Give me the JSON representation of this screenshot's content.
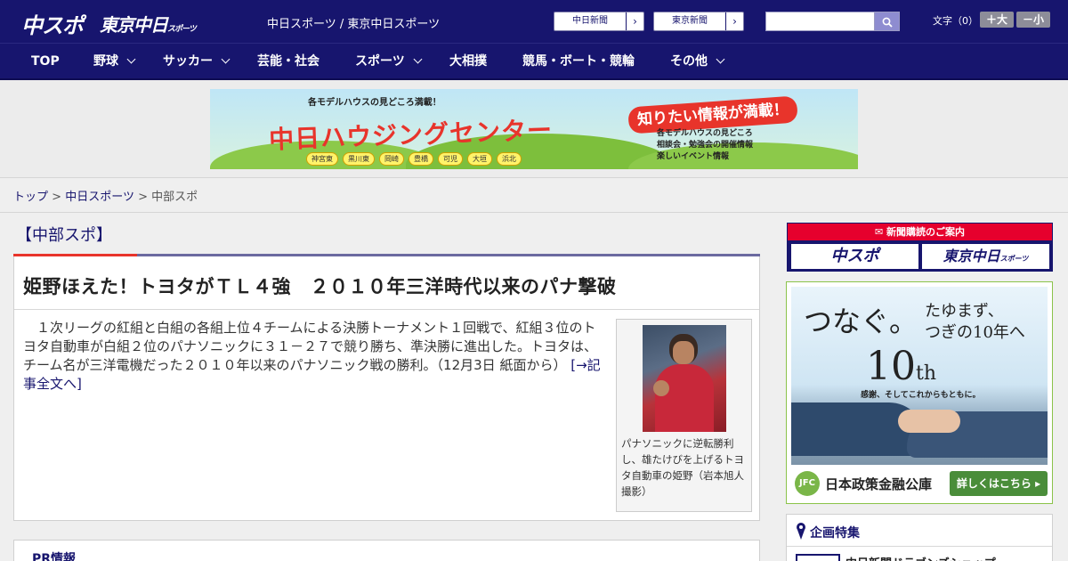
{
  "header": {
    "logo_primary": "中スポ",
    "logo_secondary": "東京中日",
    "logo_secondary_small": "スポーツ",
    "site_names": "中日スポーツ / 東京中日スポーツ",
    "link_chunichi": "中日新聞",
    "link_tokyo": "東京新聞",
    "search_placeholder": "",
    "fontsize_label": "文字（0）",
    "font_larger": "＋大",
    "font_smaller": "－小"
  },
  "nav": {
    "items": [
      {
        "label": "TOP"
      },
      {
        "label": "野球"
      },
      {
        "label": "サッカー"
      },
      {
        "label": "芸能・社会"
      },
      {
        "label": "スポーツ"
      },
      {
        "label": "大相撲"
      },
      {
        "label": "競馬・ボート・競輪"
      },
      {
        "label": "その他"
      }
    ]
  },
  "banner": {
    "subtitle": "各モデルハウスの見どころ満載！",
    "title": "中日ハウジングセンター",
    "burst": "知りたい情報が満載！",
    "info": [
      "各モデルハウスの見どころ",
      "相談会・勉強会の開催情報",
      "楽しいイベント情報"
    ],
    "cities": [
      "神宮東",
      "黒川東",
      "岡崎",
      "豊橋",
      "可児",
      "大垣",
      "浜北"
    ]
  },
  "breadcrumb": {
    "top": "トップ",
    "sep": ">",
    "parent": "中日スポーツ",
    "current": "中部スポ"
  },
  "section": {
    "title": "【中部スポ】"
  },
  "article": {
    "headline": "姫野ほえた！トヨタがＴＬ４強　２０１０年三洋時代以来のパナ撃破",
    "body": "　１次リーグの紅組と白組の各組上位４チームによる決勝トーナメント１回戦で、紅組３位のトヨタ自動車が白組２位のパナソニックに３１－２７で競り勝ち、準決勝に進出した。トヨタは、チーム名が三洋電機だった２０１０年以来のパナソニック戦の勝利。（12月3日 紙面から）",
    "more": "[→記事全文へ]",
    "photo_caption": "パナソニックに逆転勝利し、雄たけびを上げるトヨタ自動車の姫野（岩本旭人撮影）"
  },
  "pr": {
    "title": "PR情報"
  },
  "sidebar": {
    "subscribe_head": "新聞購読のご案内",
    "sub_logo_1": "中スポ",
    "sub_logo_2": "東京中日",
    "sub_logo_2_small": "スポーツ",
    "ad": {
      "headline": "つなぐ。",
      "tagline_1": "たゆまず、",
      "tagline_2": "つぎの10年へ",
      "ten_main": "10",
      "ten_suffix": "th",
      "motto": "感謝、そしてこれからもともに。",
      "org": "日本政策金融公庫",
      "org_mark": "JFC",
      "cta": "詳しくはこちら ▸"
    },
    "feature_title": "企画特集",
    "feature_item": "中日新聞ドラゴンズショップ"
  },
  "colors": {
    "brand_navy": "#17156e",
    "accent_red": "#e8342b",
    "subscribe_red": "#e6002d",
    "ad_green": "#4a8d3a"
  }
}
